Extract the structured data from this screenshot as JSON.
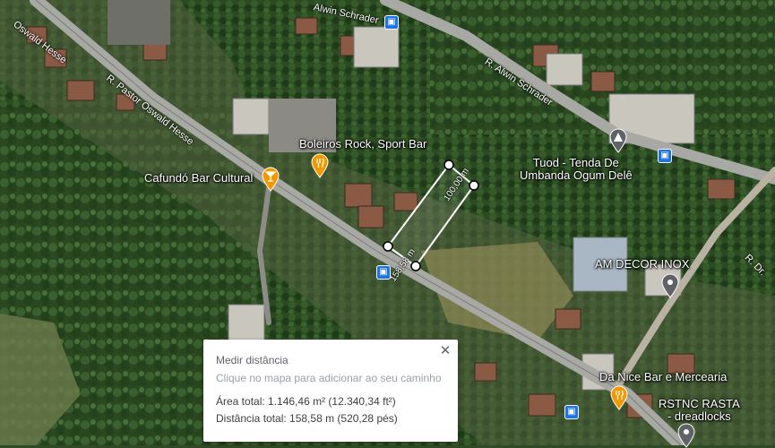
{
  "map": {
    "roads": {
      "oswald_hesse": "Oswald Hesse",
      "pastor_oswald_hesse": "R. Pastor Oswald Hesse",
      "alwin_schrader_top": "Alwin Schrader",
      "alwin_schrader": "R. Alwin Schrader",
      "dr": "R. Dr."
    },
    "places": {
      "boleiros": "Boleiros Rock, Sport Bar",
      "cafundo": "Cafundó Bar Cultural",
      "tuod_line1": "Tuod - Tenda De",
      "tuod_line2": "Umbanda Ogum Delê",
      "am_decor": "AM DECOR INOX",
      "da_nice": "Da Nice Bar e Mercearia",
      "rstnc_line1": "RSTNC RASTA",
      "rstnc_line2": "- dreadlocks"
    },
    "measurements": {
      "seg1": "100,00 m",
      "seg2": "158,58 m"
    },
    "colors": {
      "food_pin": "#f29900",
      "generic_pin": "#5f6368",
      "bus_stop": "#1a73e8",
      "measure_line": "#ffffff"
    }
  },
  "panel": {
    "title": "Medir distância",
    "hint": "Clique no mapa para adicionar ao seu caminho",
    "area": "Área total: 1.146,46 m² (12.340,34 ft²)",
    "distance": "Distância total: 158,58 m (520,28 pés)",
    "close_icon": "close-icon"
  }
}
